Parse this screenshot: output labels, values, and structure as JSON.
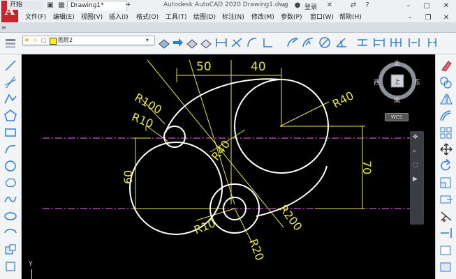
{
  "window": {
    "title": "Autodesk AutoCAD 2020    Drawing1.dwg",
    "app_logo": "A",
    "login": "登录"
  },
  "menu": [
    "文件(F)",
    "编辑(E)",
    "视图(V)",
    "插入(I)",
    "格式(O)",
    "工具(T)",
    "绘图(D)",
    "标注(N)",
    "修改(M)",
    "参数(P)",
    "窗口(W)",
    "帮助(H)"
  ],
  "tabs": {
    "start": "开始",
    "drawing": "Drawing1*",
    "add": "+"
  },
  "layer": {
    "name": "图层2"
  },
  "viewcube": {
    "north": "北",
    "south": "南",
    "east": "东",
    "west": "西",
    "face": "上",
    "wcs": "WCS"
  },
  "ucs": {
    "y_label": "Y"
  },
  "dimensions": {
    "d50": "50",
    "d40": "40",
    "d60": "60",
    "d70": "70",
    "r100": "R100",
    "r10_top": "R10",
    "r40_center": "R40",
    "r40_right": "R40",
    "r10_bottom": "R10",
    "r200": "R200",
    "r20": "R20"
  },
  "colors": {
    "canvas": "#000000",
    "drawing_lines": "#ffffff",
    "dimension": "#e6e646",
    "centerline": "#ff66ff",
    "logo": "#c8262d"
  }
}
